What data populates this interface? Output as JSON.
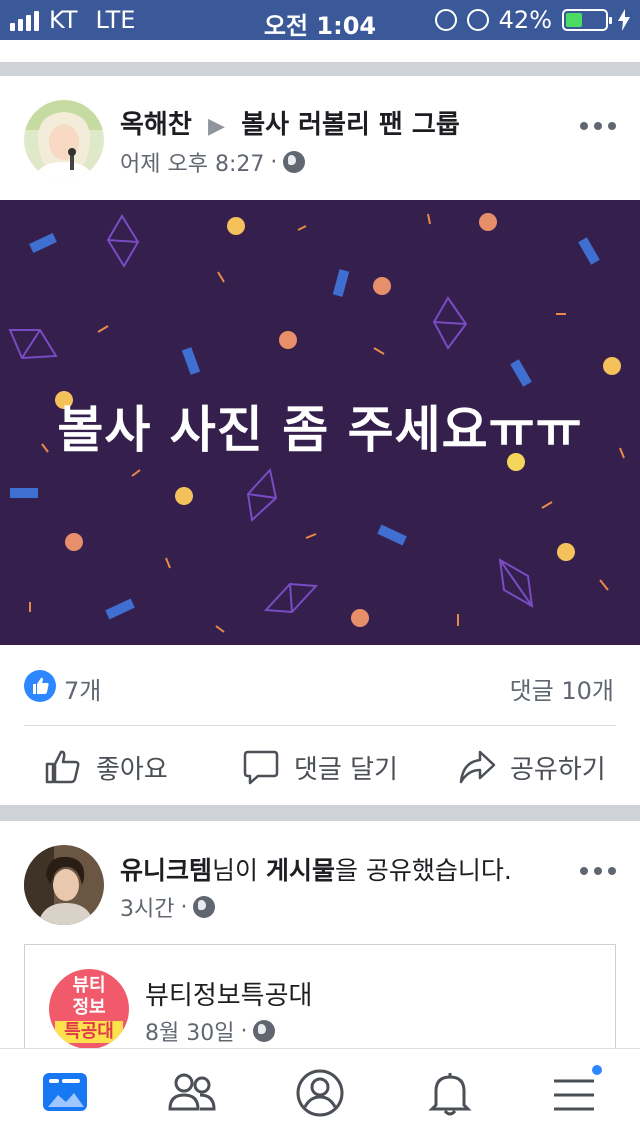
{
  "status_bar": {
    "carrier": "KT",
    "network": "LTE",
    "time": "오전 1:04",
    "battery_percent_label": "42%",
    "battery_level": 0.42
  },
  "post1": {
    "author": "옥해찬",
    "arrow": "▶",
    "group": "볼사 러볼리 팬 그룹",
    "timestamp": "어제 오후 8:27",
    "dot": "·",
    "banner_text": "볼사 사진 좀 주세요ㅠㅠ",
    "banner_color": "#341f4d",
    "reaction_count": "7개",
    "comment_count": "댓글 10개",
    "actions": {
      "like": "좋아요",
      "comment": "댓글 달기",
      "share": "공유하기"
    }
  },
  "post2": {
    "author": "유니크템",
    "suffix1": "님이 ",
    "object": "게시물",
    "suffix2": "을 공유했습니다.",
    "timestamp": "3시간",
    "dot": "·",
    "shared": {
      "page_name": "뷰티정보특공대",
      "timestamp": "8월 30일",
      "dot": "·",
      "logo_line1": "뷰티",
      "logo_line2": "정보",
      "logo_line3": "특공대"
    }
  },
  "bottom_nav": [
    "news-feed",
    "friends",
    "profile",
    "notifications",
    "menu"
  ],
  "colors": {
    "brand_blue": "#3b5998",
    "like_blue": "#2d88ff",
    "separator": "#cfd2d6"
  }
}
